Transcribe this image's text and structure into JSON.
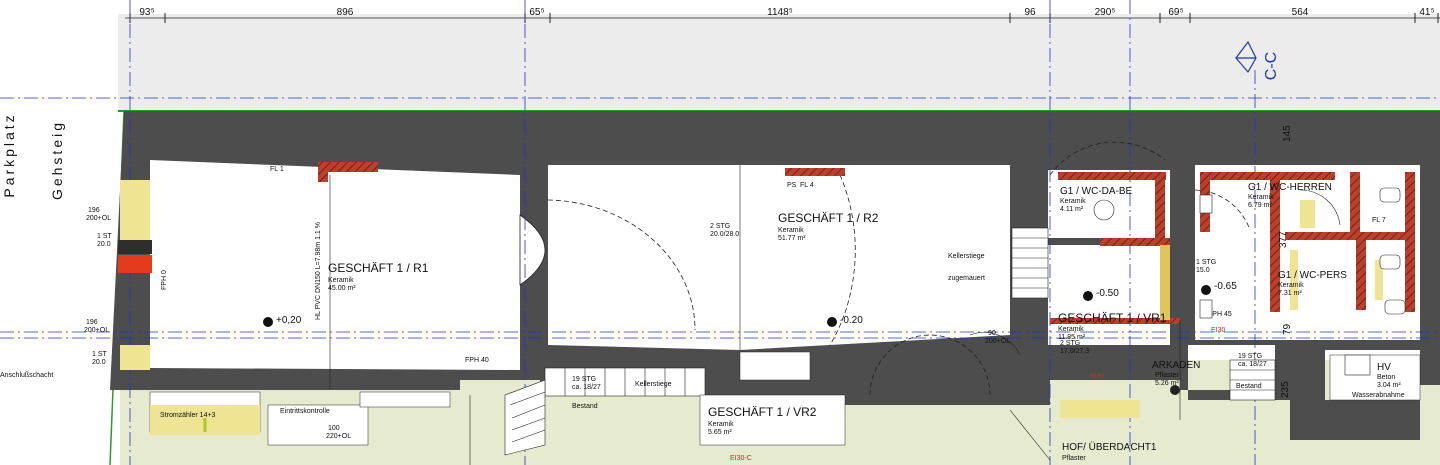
{
  "dimensions": [
    "93⁵",
    "896",
    "65⁵",
    "1148⁵",
    "96",
    "290⁵",
    "69⁵",
    "564",
    "41⁵"
  ],
  "section_label": "C-C",
  "streets": {
    "square": "Parkplatz",
    "sidewalk": "Gehsteig"
  },
  "rooms": {
    "r1": {
      "name": "GESCHÄFT 1 /  R1",
      "floor": "Keramik",
      "area": "45.00 m²"
    },
    "r2": {
      "name": "GESCHÄFT 1 /  R2",
      "floor": "Keramik",
      "area": "51.77 m²"
    },
    "vr1": {
      "name": "GESCHÄFT 1 / VR1",
      "floor": "Keramik",
      "area": "11.85 m²"
    },
    "vr2": {
      "name": "GESCHÄFT 1 / VR2",
      "floor": "Keramik",
      "area": "5.65 m²"
    },
    "wc_dabe": {
      "name": "G1 / WC-DA-BE",
      "floor": "Keramik",
      "area": "4.11 m²"
    },
    "wc_herren": {
      "name": "G1 / WC-HERREN",
      "floor": "Keramik",
      "area": "6.79 m²"
    },
    "wc_pers": {
      "name": "G1 / WC-PERS",
      "floor": "Keramik",
      "area": "7.31 m²"
    },
    "arkaden": {
      "name": "ARKADEN",
      "floor": "Pflaster",
      "area": "5.26 m²"
    },
    "hv": {
      "name": "HV",
      "floor": "Beton",
      "area": "3.04 m²"
    },
    "hof": {
      "name": "HOF/ ÜBERDACHT1",
      "floor": "Pflaster"
    }
  },
  "levels": {
    "r1": "+0,20",
    "r2": "-0.20",
    "vr1": "-0.50",
    "wc": "-0.65"
  },
  "labels": {
    "fl1": "FL 1",
    "fl4": "FL 4",
    "fl7": "FL 7",
    "ps": "PS",
    "fph0": "FPH 0",
    "fph40": "FPH 40",
    "fph45": "FPH 45",
    "pipe": "HL PVC DN150 L=7.98m   1.1 %",
    "stg2": "2 STG",
    "stg2_dims": "20.0/28.0",
    "kellerstiege": "Kellerstiege",
    "zugemauert": "zugemauert",
    "kellerstiege2": "Kellerstiege",
    "stg19a": "19 STG",
    "stg19a_dims": "ca. 18/27",
    "stg19b": "19 STG",
    "stg19b_dims": "ca. 18/27",
    "bestand1": "Bestand",
    "bestand2": "Bestand",
    "stromzaehler": "Stromzähler 14+3",
    "eintritt": "Eintrittskontrolle",
    "wasser": "Wasserabnahme",
    "ei30a": "EI30",
    "ei30b": "EI30",
    "ei30c": "EI30-C",
    "stg1_a": "1 ST",
    "stg1_a_val": "20.0",
    "stg1_b": "1 ST",
    "stg1_b_val": "20.0",
    "stg1_c": "1 STG",
    "stg1_c_val": "15.0",
    "stg2_vr1": "2 STG",
    "stg2_vr1_val": "17.0/27.3",
    "w196a": "196",
    "w200a": "200+OL",
    "w196b": "196",
    "w200b": "200+OL",
    "w100": "100",
    "w220": "220+OL",
    "w90": "90",
    "w200c": "200+OL",
    "d145": "145",
    "d377": "377",
    "d79": "79",
    "d235": "235",
    "anschluss": "Anschlußschacht"
  }
}
